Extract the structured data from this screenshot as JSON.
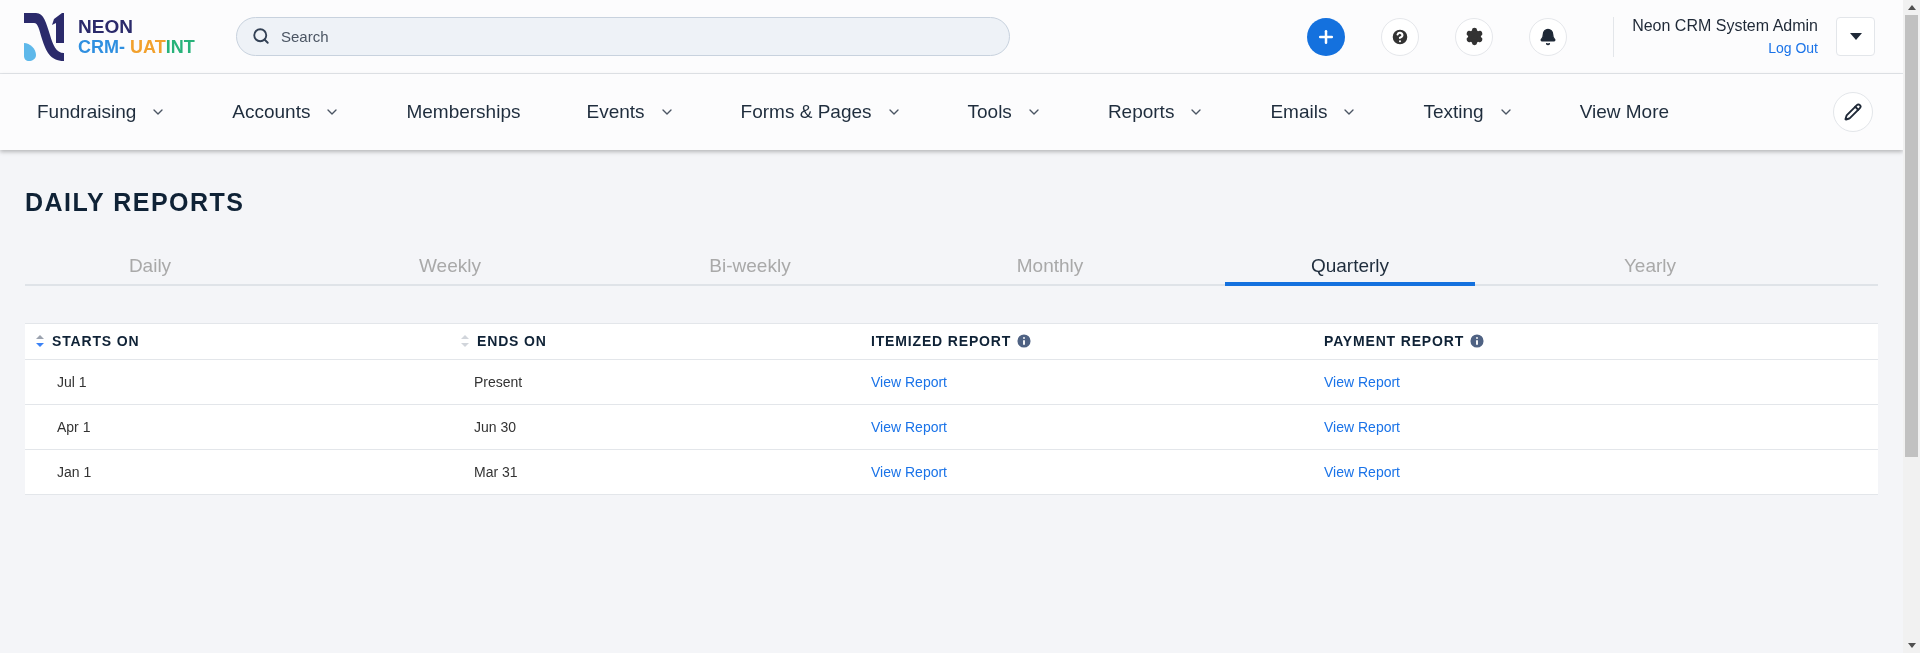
{
  "logo": {
    "line1": "NEON",
    "line2_a": "CRM-",
    "line2_b": "UAT",
    "line2_c": "INT"
  },
  "search": {
    "placeholder": "Search"
  },
  "user": {
    "name": "Neon CRM System Admin",
    "logout": "Log Out"
  },
  "nav": [
    {
      "label": "Fundraising",
      "dropdown": true
    },
    {
      "label": "Accounts",
      "dropdown": true
    },
    {
      "label": "Memberships",
      "dropdown": false
    },
    {
      "label": "Events",
      "dropdown": true
    },
    {
      "label": "Forms & Pages",
      "dropdown": true
    },
    {
      "label": "Tools",
      "dropdown": true
    },
    {
      "label": "Reports",
      "dropdown": true
    },
    {
      "label": "Emails",
      "dropdown": true
    },
    {
      "label": "Texting",
      "dropdown": true
    },
    {
      "label": "View More",
      "dropdown": false
    }
  ],
  "page_title": "DAILY REPORTS",
  "tabs": [
    {
      "label": "Daily",
      "selected": false
    },
    {
      "label": "Weekly",
      "selected": false
    },
    {
      "label": "Bi-weekly",
      "selected": false
    },
    {
      "label": "Monthly",
      "selected": false
    },
    {
      "label": "Quarterly",
      "selected": true
    },
    {
      "label": "Yearly",
      "selected": false
    }
  ],
  "table": {
    "columns": [
      {
        "label": "STARTS ON",
        "kind": "sort",
        "sorted": true
      },
      {
        "label": "ENDS ON",
        "kind": "sort",
        "sorted": false
      },
      {
        "label": "ITEMIZED REPORT",
        "kind": "info"
      },
      {
        "label": "PAYMENT REPORT",
        "kind": "info"
      }
    ],
    "rows": [
      {
        "cells": [
          "Jul 1",
          "Present",
          "View Report",
          "View Report"
        ]
      },
      {
        "cells": [
          "Apr 1",
          "Jun 30",
          "View Report",
          "View Report"
        ]
      },
      {
        "cells": [
          "Jan 1",
          "Mar 31",
          "View Report",
          "View Report"
        ]
      }
    ]
  }
}
